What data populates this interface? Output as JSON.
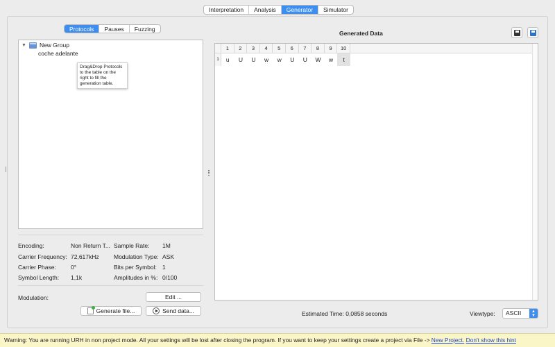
{
  "main_tabs": [
    {
      "label": "Interpretation",
      "active": false
    },
    {
      "label": "Analysis",
      "active": false
    },
    {
      "label": "Generator",
      "active": true
    },
    {
      "label": "Simulator",
      "active": false
    }
  ],
  "sub_tabs": [
    {
      "label": "Protocols",
      "active": true
    },
    {
      "label": "Pauses",
      "active": false
    },
    {
      "label": "Fuzzing",
      "active": false
    }
  ],
  "tree": {
    "group_label": "New Group",
    "item_label": "coche adelante",
    "tooltip": "Drag&Drop Protocols to the table on the right to fill the generation table."
  },
  "settings": {
    "encoding_label": "Encoding:",
    "encoding_value": "Non Return T...",
    "sample_rate_label": "Sample Rate:",
    "sample_rate_value": "1M",
    "carrier_freq_label": "Carrier Frequency:",
    "carrier_freq_value": "72,617kHz",
    "modulation_type_label": "Modulation Type:",
    "modulation_type_value": "ASK",
    "carrier_phase_label": "Carrier Phase:",
    "carrier_phase_value": "0°",
    "bits_per_symbol_label": "Bits per Symbol:",
    "bits_per_symbol_value": "1",
    "symbol_length_label": "Symbol Length:",
    "symbol_length_value": "1,1k",
    "amplitudes_label": "Amplitudes in %:",
    "amplitudes_value": "0/100",
    "modulation_label": "Modulation:",
    "edit_button": "Edit ..."
  },
  "buttons": {
    "generate_file": "Generate file...",
    "send_data": "Send data..."
  },
  "generated": {
    "title": "Generated Data",
    "columns": [
      "1",
      "2",
      "3",
      "4",
      "5",
      "6",
      "7",
      "8",
      "9",
      "10"
    ],
    "rows": [
      {
        "index": "1",
        "cells": [
          "u",
          "U",
          "U",
          "w",
          "w",
          "U",
          "U",
          "W",
          "w",
          "t"
        ]
      }
    ],
    "selected_cell": "t"
  },
  "footer": {
    "estimated_time": "Estimated Time: 0,0858 seconds",
    "viewtype_label": "Viewtype:",
    "viewtype_value": "ASCII"
  },
  "warning": {
    "text": "Warning: You are running URH in non project mode. All your settings will be lost after closing the program. If you want to keep your settings create a project via File -> ",
    "link_new_project": "New Project.",
    "link_dont_show": "Don't show this hint"
  },
  "icons": [
    "folder-icon",
    "expand-triangle-icon",
    "save-icon",
    "save-as-icon",
    "generate-file-icon",
    "play-icon",
    "chevron-updown-icon"
  ],
  "colors": {
    "accent": "#3e8ef0",
    "warning_bg": "#fbf6c8",
    "link": "#1c45c6"
  }
}
